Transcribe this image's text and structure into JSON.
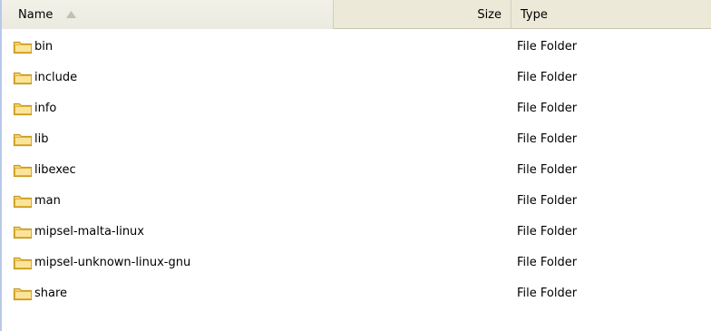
{
  "columns": {
    "name": "Name",
    "size": "Size",
    "type": "Type",
    "sort_direction": "ascending"
  },
  "icons": {
    "folder": "folder-icon",
    "sort": "sort-ascending-icon"
  },
  "colors": {
    "header_bg": "#ece9d8",
    "sorted_column_bg": "#f2f1e8",
    "folder_fill": "#f7d56b",
    "folder_stroke": "#c79a1f"
  },
  "files": [
    {
      "name": "bin",
      "size": "",
      "type": "File Folder"
    },
    {
      "name": "include",
      "size": "",
      "type": "File Folder"
    },
    {
      "name": "info",
      "size": "",
      "type": "File Folder"
    },
    {
      "name": "lib",
      "size": "",
      "type": "File Folder"
    },
    {
      "name": "libexec",
      "size": "",
      "type": "File Folder"
    },
    {
      "name": "man",
      "size": "",
      "type": "File Folder"
    },
    {
      "name": "mipsel-malta-linux",
      "size": "",
      "type": "File Folder"
    },
    {
      "name": "mipsel-unknown-linux-gnu",
      "size": "",
      "type": "File Folder"
    },
    {
      "name": "share",
      "size": "",
      "type": "File Folder"
    }
  ]
}
